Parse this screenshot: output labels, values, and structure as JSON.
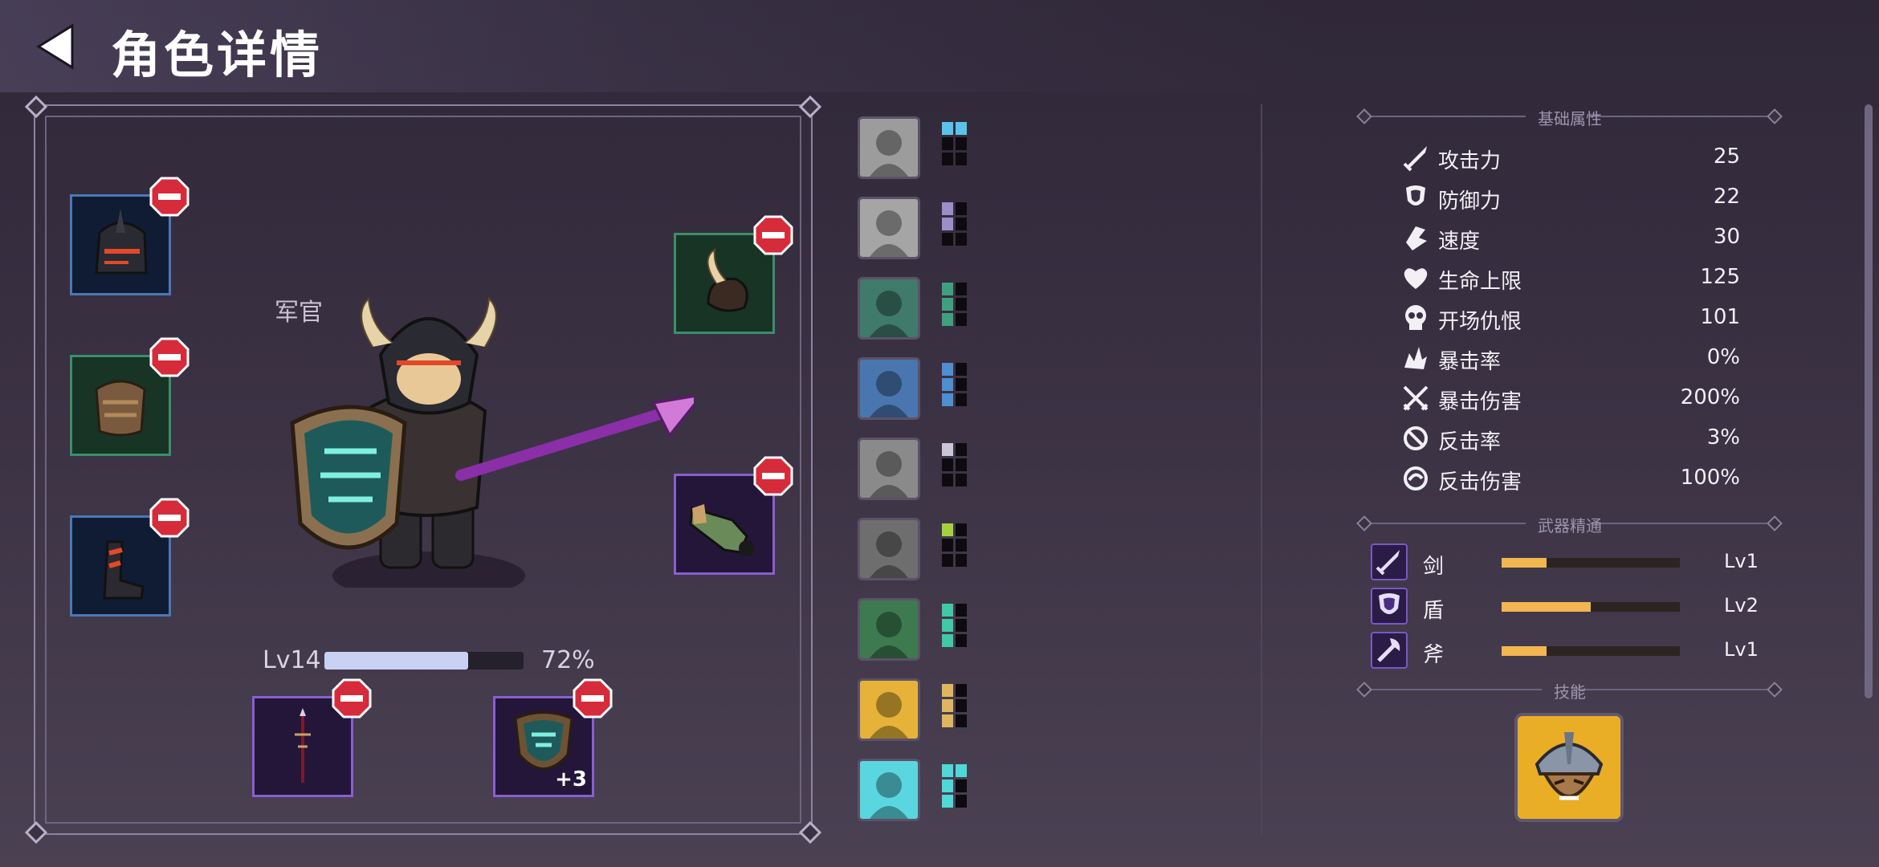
{
  "header": {
    "title": "角色详情",
    "back_icon": "back-arrow-icon"
  },
  "character": {
    "name": "军官",
    "level_label": "Lv14",
    "xp_percent_label": "72%",
    "xp_fraction": 0.72
  },
  "equipment_slots": [
    {
      "id": "helmet",
      "icon": "helmet-icon",
      "rarity_color": "#4b78b4"
    },
    {
      "id": "body-armor",
      "icon": "chest-armor-icon",
      "rarity_color": "#3c8e6a"
    },
    {
      "id": "boots",
      "icon": "boots-icon",
      "rarity_color": "#4b78b4"
    },
    {
      "id": "shoulder",
      "icon": "horned-pauldron-icon",
      "rarity_color": "#3c8e6a"
    },
    {
      "id": "gloves",
      "icon": "gauntlet-icon",
      "rarity_color": "#8a5ed0"
    },
    {
      "id": "weapon",
      "icon": "sword-icon",
      "rarity_color": "#8a5ed0"
    },
    {
      "id": "shield",
      "icon": "shield-icon",
      "rarity_color": "#8a5ed0",
      "enhancement": "+3"
    }
  ],
  "portraits": [
    {
      "icon": "portrait-grey-warrior",
      "color": "#9c9c9c",
      "pips": [
        "#5ac3ea",
        "#5ac3ea",
        "#0d0b10",
        "#0d0b10",
        "#0d0b10",
        "#0d0b10"
      ]
    },
    {
      "icon": "portrait-grey-knight",
      "color": "#a5a5a5",
      "pips": [
        "#9a8fc9",
        "#0d0b10",
        "#9a8fc9",
        "#0d0b10",
        "#0d0b10",
        "#0d0b10"
      ]
    },
    {
      "icon": "portrait-green-rogue",
      "color": "#3f7a6b",
      "pips": [
        "#3fa07f",
        "#0d0b10",
        "#3fa07f",
        "#0d0b10",
        "#3fa07f",
        "#0d0b10"
      ]
    },
    {
      "icon": "portrait-blue-fighter",
      "color": "#4a76b0",
      "pips": [
        "#4d8fd0",
        "#0d0b10",
        "#4d8fd0",
        "#0d0b10",
        "#4d8fd0",
        "#0d0b10"
      ]
    },
    {
      "icon": "portrait-grey-axe",
      "color": "#8a8a8a",
      "pips": [
        "#c9c6d6",
        "#0d0b10",
        "#0d0b10",
        "#0d0b10",
        "#0d0b10",
        "#0d0b10"
      ]
    },
    {
      "icon": "portrait-grey-hood",
      "color": "#6e6e6e",
      "pips": [
        "#a6d13d",
        "#0d0b10",
        "#0d0b10",
        "#0d0b10",
        "#0d0b10",
        "#0d0b10"
      ]
    },
    {
      "icon": "portrait-green-hood",
      "color": "#3d7a4f",
      "pips": [
        "#3fc9a5",
        "#0d0b10",
        "#3fc9a5",
        "#0d0b10",
        "#3fc9a5",
        "#0d0b10"
      ]
    },
    {
      "icon": "portrait-yellow-hand",
      "color": "#e6b23a",
      "pips": [
        "#e1b460",
        "#0d0b10",
        "#e1b460",
        "#0d0b10",
        "#e1b460",
        "#0d0b10"
      ]
    },
    {
      "icon": "portrait-cyan-crystal",
      "color": "#5ad6e0",
      "pips": [
        "#4fd8d8",
        "#4fd8d8",
        "#4fd8d8",
        "#0d0b10",
        "#4fd8d8",
        "#0d0b10"
      ]
    }
  ],
  "stats_section": {
    "title": "基础属性",
    "rows": [
      {
        "icon": "sword-icon",
        "label": "攻击力",
        "value": "25"
      },
      {
        "icon": "shield-icon",
        "label": "防御力",
        "value": "22"
      },
      {
        "icon": "boot-speed-icon",
        "label": "速度",
        "value": "30"
      },
      {
        "icon": "heart-icon",
        "label": "生命上限",
        "value": "125"
      },
      {
        "icon": "skull-icon",
        "label": "开场仇恨",
        "value": "101"
      },
      {
        "icon": "crit-burst-icon",
        "label": "暴击率",
        "value": "0%"
      },
      {
        "icon": "crossed-swords-icon",
        "label": "暴击伤害",
        "value": "200%"
      },
      {
        "icon": "counter-icon",
        "label": "反击率",
        "value": "3%"
      },
      {
        "icon": "counter-damage-icon",
        "label": "反击伤害",
        "value": "100%"
      }
    ]
  },
  "mastery_section": {
    "title": "武器精通",
    "rows": [
      {
        "icon": "sword-icon",
        "label": "剑",
        "level": "Lv1",
        "progress": 0.25
      },
      {
        "icon": "shield-icon",
        "label": "盾",
        "level": "Lv2",
        "progress": 0.5
      },
      {
        "icon": "axe-icon",
        "label": "斧",
        "level": "Lv1",
        "progress": 0.25
      }
    ]
  },
  "skills_section": {
    "title": "技能",
    "skill_icon": "helmeted-soldier-skill-icon"
  }
}
